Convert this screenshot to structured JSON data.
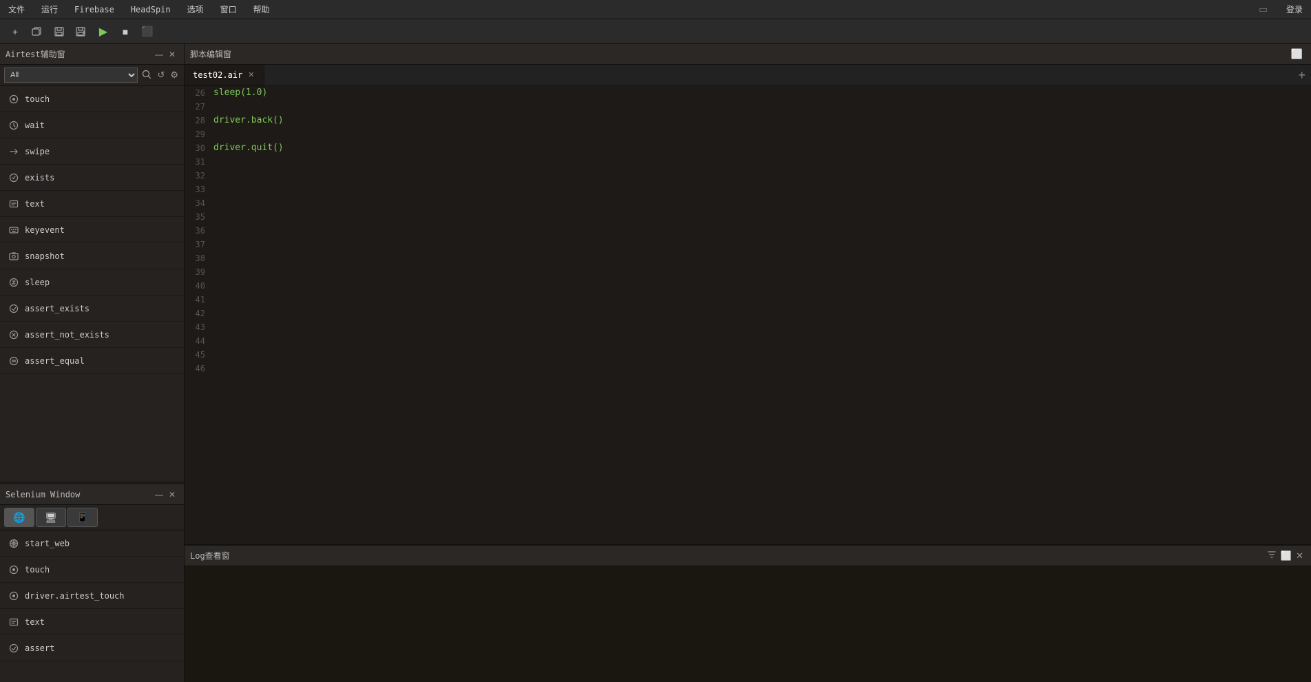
{
  "menuBar": {
    "items": [
      "文件",
      "运行",
      "Firebase",
      "HeadSpin",
      "选项",
      "窗口",
      "帮助"
    ],
    "rightItems": [
      "登录"
    ]
  },
  "toolbar": {
    "buttons": [
      {
        "name": "new",
        "icon": "+"
      },
      {
        "name": "open",
        "icon": "📁"
      },
      {
        "name": "save",
        "icon": "💾"
      },
      {
        "name": "saveas",
        "icon": "💾"
      },
      {
        "name": "run",
        "icon": "▶"
      },
      {
        "name": "stop",
        "icon": "■"
      },
      {
        "name": "record",
        "icon": "⬛"
      }
    ]
  },
  "leftPanel": {
    "title": "Airtest辅助窗",
    "searchPlaceholder": "All",
    "items": [
      {
        "label": "touch",
        "icon": "touch"
      },
      {
        "label": "wait",
        "icon": "wait"
      },
      {
        "label": "swipe",
        "icon": "swipe"
      },
      {
        "label": "exists",
        "icon": "exists"
      },
      {
        "label": "text",
        "icon": "text"
      },
      {
        "label": "keyevent",
        "icon": "keyevent"
      },
      {
        "label": "snapshot",
        "icon": "snapshot"
      },
      {
        "label": "sleep",
        "icon": "sleep"
      },
      {
        "label": "assert_exists",
        "icon": "assert"
      },
      {
        "label": "assert_not_exists",
        "icon": "assert"
      },
      {
        "label": "assert_equal",
        "icon": "assert"
      }
    ]
  },
  "seleniumPanel": {
    "title": "Selenium Window",
    "tabs": [
      {
        "name": "globe",
        "icon": "🌐"
      },
      {
        "name": "screen",
        "icon": "🖥"
      },
      {
        "name": "devices",
        "icon": "📱"
      }
    ],
    "items": [
      {
        "label": "start_web",
        "icon": "web"
      },
      {
        "label": "touch",
        "icon": "touch"
      },
      {
        "label": "driver.airtest_touch",
        "icon": "touch"
      },
      {
        "label": "text",
        "icon": "text"
      },
      {
        "label": "assert",
        "icon": "assert"
      }
    ]
  },
  "editorHeader": {
    "title": "脚本编辑窗"
  },
  "editorTab": {
    "label": "test02.air",
    "addLabel": "+"
  },
  "codeLines": [
    {
      "number": "26",
      "content": "sleep(1.0)",
      "type": "green"
    },
    {
      "number": "27",
      "content": "",
      "type": "empty"
    },
    {
      "number": "28",
      "content": "driver.back()",
      "type": "green"
    },
    {
      "number": "29",
      "content": "",
      "type": "empty"
    },
    {
      "number": "30",
      "content": "driver.quit()",
      "type": "green"
    },
    {
      "number": "31",
      "content": "",
      "type": "empty"
    },
    {
      "number": "32",
      "content": "",
      "type": "empty"
    },
    {
      "number": "33",
      "content": "",
      "type": "empty"
    },
    {
      "number": "34",
      "content": "",
      "type": "empty"
    },
    {
      "number": "35",
      "content": "",
      "type": "empty"
    },
    {
      "number": "36",
      "content": "",
      "type": "empty"
    },
    {
      "number": "37",
      "content": "",
      "type": "empty"
    },
    {
      "number": "38",
      "content": "",
      "type": "empty"
    },
    {
      "number": "39",
      "content": "",
      "type": "empty"
    },
    {
      "number": "40",
      "content": "",
      "type": "empty"
    },
    {
      "number": "41",
      "content": "",
      "type": "empty"
    },
    {
      "number": "42",
      "content": "",
      "type": "empty"
    },
    {
      "number": "43",
      "content": "",
      "type": "empty"
    },
    {
      "number": "44",
      "content": "",
      "type": "empty"
    },
    {
      "number": "45",
      "content": "",
      "type": "empty"
    },
    {
      "number": "46",
      "content": "",
      "type": "empty"
    }
  ],
  "logViewer": {
    "title": "Log查看窗"
  }
}
